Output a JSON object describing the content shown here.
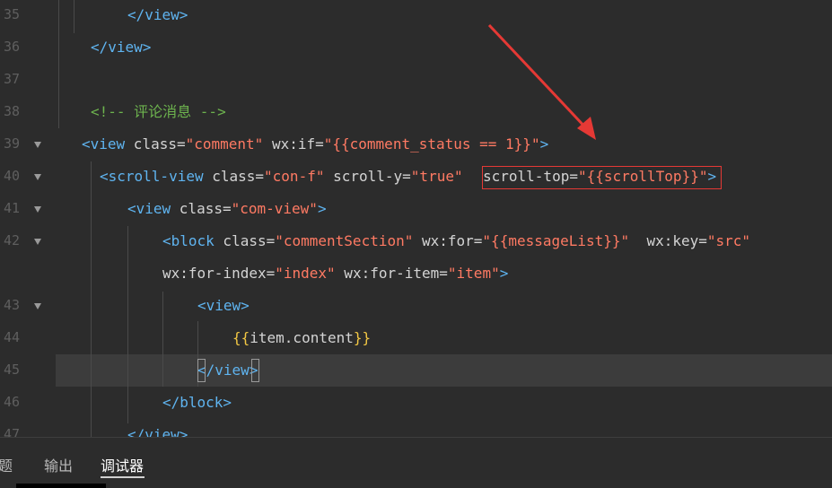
{
  "editor": {
    "line_numbers": [
      "35",
      "36",
      "37",
      "38",
      "39",
      "40",
      "41",
      "42",
      "43",
      "44",
      "45",
      "46",
      "47"
    ],
    "comment_line": "<!-- 评论消息 -->",
    "line39": {
      "open": "<view",
      "attr1": " class=",
      "val1": "\"comment\"",
      "attr2": " wx:if=",
      "val2": "\"{{comment_status == 1}}\"",
      "close": ">"
    },
    "line40": {
      "open": "<scroll-view",
      "attr1": " class=",
      "val1": "\"con-f\"",
      "attr2": " scroll-y=",
      "val2": "\"true\"",
      "attr3": "scroll-top=",
      "val3": "\"{{scrollTop}}\"",
      "close": ">"
    },
    "line41": {
      "open": "<view",
      "attr": " class=",
      "val": "\"com-view\"",
      "close": ">"
    },
    "line42a": {
      "open": "<block",
      "attr1": " class=",
      "val1": "\"commentSection\"",
      "attr2": " wx:for=",
      "val2": "\"{{messageList}}\"",
      "attr3": "  wx:key=",
      "val3": "\"src\""
    },
    "line42b": {
      "attr1": "wx:for-index=",
      "val1": "\"index\"",
      "attr2": " wx:for-item=",
      "val2": "\"item\"",
      "close": ">"
    },
    "close_view": "</view>",
    "open_view": "<view>",
    "mustache_open": "{{",
    "mustache_text": "item.content",
    "mustache_close": "}}",
    "close_block": "</block>",
    "line45_lt": "<",
    "line45_mid": "/view",
    "line45_gt": ">"
  },
  "bottom_panel": {
    "tabs": [
      "题",
      "输出",
      "调试器"
    ],
    "active_tab": "调试器"
  },
  "colors": {
    "background": "#2c2c2c",
    "tag": "#5fb4f0",
    "string": "#ff7a63",
    "comment": "#6db34e",
    "mustache": "#f2c744",
    "highlight_box": "#e53935",
    "arrow": "#e53935"
  }
}
